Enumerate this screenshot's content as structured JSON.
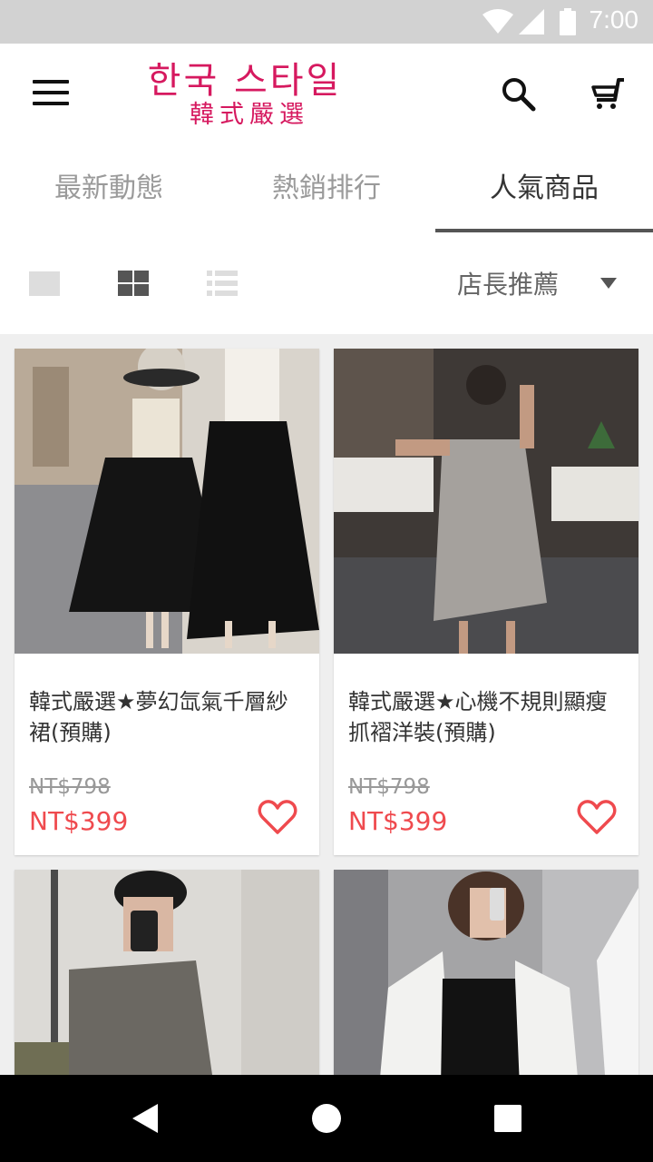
{
  "status_bar": {
    "time": "7:00",
    "icons": [
      "wifi-icon",
      "signal-icon",
      "battery-icon"
    ]
  },
  "app_bar": {
    "logo_korean": "한국 스타일",
    "logo_chinese": "韓式嚴選",
    "icons": [
      "menu-icon",
      "search-icon",
      "cart-icon"
    ],
    "brand_color": "#d6195f"
  },
  "tabs": [
    {
      "label": "最新動態",
      "active": false
    },
    {
      "label": "熱銷排行",
      "active": false
    },
    {
      "label": "人氣商品",
      "active": true
    }
  ],
  "toolbar": {
    "view_modes": [
      "single-view-icon",
      "grid-view-icon",
      "list-view-icon"
    ],
    "active_view": "grid-view-icon",
    "sort": {
      "selected": "店長推薦"
    }
  },
  "products": [
    {
      "name": "韓式嚴選★夢幻氙氣千層紗裙(預購)",
      "original_price": "NT$798",
      "price": "NT$399",
      "favorite": false
    },
    {
      "name": "韓式嚴選★心機不規則顯瘦抓褶洋裝(預購)",
      "original_price": "NT$798",
      "price": "NT$399",
      "favorite": false
    },
    {
      "name": "",
      "original_price": "",
      "price": ""
    },
    {
      "name": "",
      "original_price": "",
      "price": ""
    }
  ],
  "colors": {
    "price": "#ef4a4e",
    "heart": "#ef4a4e",
    "tab_indicator": "#555555"
  },
  "nav_bar": {
    "icons": [
      "back-icon",
      "home-icon",
      "recents-icon"
    ]
  }
}
